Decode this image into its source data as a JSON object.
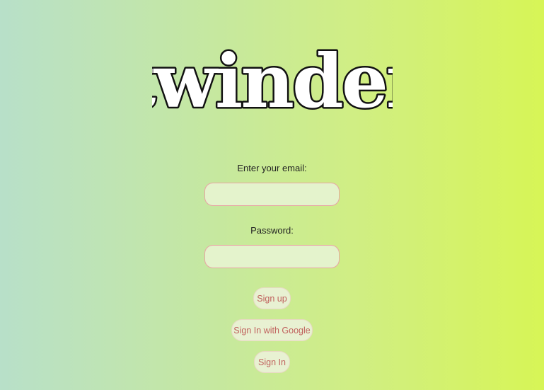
{
  "logo": {
    "text": "twinder"
  },
  "form": {
    "email_label": "Enter your email:",
    "email_value": "",
    "email_placeholder": "",
    "password_label": "Password:",
    "password_value": "",
    "password_placeholder": ""
  },
  "buttons": {
    "sign_up": "Sign up",
    "sign_in_google": "Sign In with Google",
    "sign_in": "Sign In"
  },
  "colors": {
    "background_left": "#b8e0c9",
    "background_right": "#d7f556",
    "input_border": "#e8a4a4",
    "button_text": "#c0625e"
  }
}
